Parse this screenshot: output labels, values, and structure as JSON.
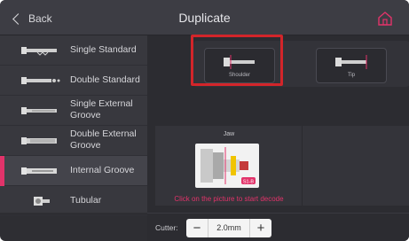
{
  "header": {
    "back_label": "Back",
    "title": "Duplicate"
  },
  "sidebar": {
    "items": [
      {
        "label": "Single Standard",
        "icon": "single-standard-key-icon"
      },
      {
        "label": "Double Standard",
        "icon": "double-standard-key-icon"
      },
      {
        "label": "Single External Groove",
        "icon": "single-external-groove-key-icon"
      },
      {
        "label": "Double External Groove",
        "icon": "double-external-groove-key-icon"
      },
      {
        "label": "Internal Groove",
        "icon": "internal-groove-key-icon",
        "active": true
      },
      {
        "label": "Tubular",
        "icon": "tubular-key-icon"
      }
    ]
  },
  "modes": {
    "shoulder_label": "Shoulder",
    "tip_label": "Tip",
    "selected": "Shoulder"
  },
  "decode": {
    "jaw_label": "Jaw",
    "badge_text": "S1-B",
    "hint": "Click on the picture to start decode"
  },
  "cutter": {
    "label": "Cutter:",
    "value": "2.0mm",
    "minus": "−",
    "plus": "+"
  },
  "colors": {
    "accent": "#e2336a",
    "highlight": "#d3252a",
    "background": "#2e2e33"
  }
}
